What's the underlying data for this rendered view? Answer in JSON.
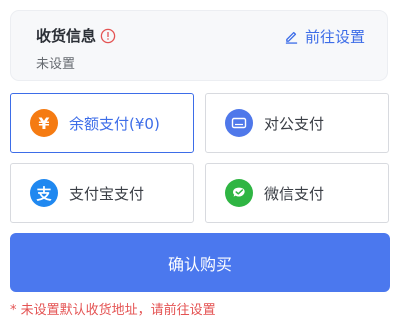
{
  "shipping": {
    "title": "收货信息",
    "status": "未设置",
    "action_label": "前往设置"
  },
  "payment": {
    "options": [
      {
        "key": "balance",
        "label": "余额支付(¥0)",
        "icon": "yen-icon",
        "icon_glyph": "¥",
        "selected": true
      },
      {
        "key": "corporate",
        "label": "对公支付",
        "icon": "card-icon",
        "selected": false
      },
      {
        "key": "alipay",
        "label": "支付宝支付",
        "icon": "alipay-icon",
        "icon_glyph": "支",
        "selected": false
      },
      {
        "key": "wechat",
        "label": "微信支付",
        "icon": "wechat-pay-icon",
        "selected": false
      }
    ]
  },
  "confirm": {
    "label": "确认购买"
  },
  "hint": "* 未设置默认收货地址，请前往设置",
  "colors": {
    "accent": "#4b78ee",
    "warning": "#e45353",
    "balance_icon": "#f57b12",
    "corporate_icon": "#4f78ea",
    "alipay_icon": "#1f88f0",
    "wechat_icon": "#2fb543"
  }
}
